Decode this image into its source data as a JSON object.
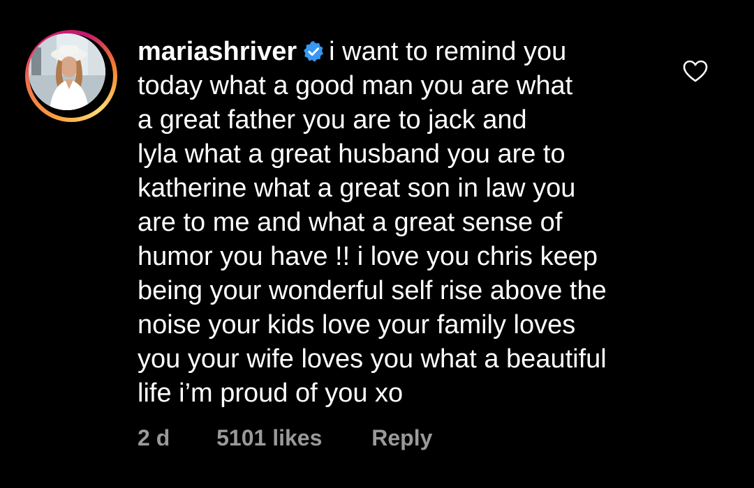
{
  "comment": {
    "username": "mariashriver",
    "verified": true,
    "text_lines": [
      "i want to remind you",
      "today what a good man you are what",
      "a great father you are to jack and",
      "lyla what a great husband you are to",
      "katherine  what a great son in law you",
      "are to me  and what a great sense of",
      "humor you have !! i love you chris keep",
      "being your wonderful self rise above the",
      "noise your kids love your family loves",
      "you your wife loves you what a beautiful",
      "life i’m proud of you xo"
    ],
    "time": "2 d",
    "likes": "5101 likes",
    "reply_label": "Reply"
  },
  "icons": {
    "verified": "verified-badge-icon",
    "like": "heart-outline-icon"
  },
  "colors": {
    "background": "#000000",
    "text": "#ffffff",
    "meta_text": "#9a9a9a",
    "verified_blue": "#3897f0"
  }
}
